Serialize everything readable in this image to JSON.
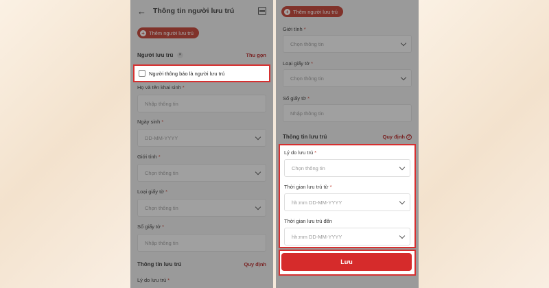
{
  "header": {
    "title": "Thông tin người lưu trú"
  },
  "add_guest_label": "Thêm người lưu trú",
  "left": {
    "section": {
      "title": "Người lưu trú",
      "collapse_link": "Thu gọn"
    },
    "checkbox_label": "Người thông báo là người lưu trú",
    "fields": [
      {
        "label": "Họ và tên khai sinh",
        "placeholder": "Nhập thông tin"
      },
      {
        "label": "Ngày sinh",
        "placeholder": "DD-MM-YYYY"
      },
      {
        "label": "Giới tính",
        "placeholder": "Chọn thông tin"
      },
      {
        "label": "Loại giấy tờ",
        "placeholder": "Chọn thông tin"
      },
      {
        "label": "Số giấy tờ",
        "placeholder": "Nhập thông tin"
      }
    ],
    "stay_section": {
      "title": "Thông tin lưu trú",
      "rule_link": "Quy định"
    },
    "stay_reason_label": "Lý do lưu trú"
  },
  "right": {
    "fields": [
      {
        "label": "Giới tính",
        "placeholder": "Chọn thông tin"
      },
      {
        "label": "Loại giấy tờ",
        "placeholder": "Chọn thông tin"
      },
      {
        "label": "Số giấy tờ",
        "placeholder": "Nhập thông tin"
      }
    ],
    "stay_section": {
      "title": "Thông tin lưu trú",
      "rule_link": "Quy định"
    },
    "stay_fields": [
      {
        "label": "Lý do lưu trú",
        "placeholder": "Chọn thông tin"
      },
      {
        "label": "Thời gian lưu trú từ",
        "placeholder": "hh:mm DD-MM-YYYY"
      },
      {
        "label": "Thời gian lưu trú đến",
        "placeholder": "hh:mm DD-MM-YYYY"
      }
    ],
    "save_label": "Lưu"
  }
}
